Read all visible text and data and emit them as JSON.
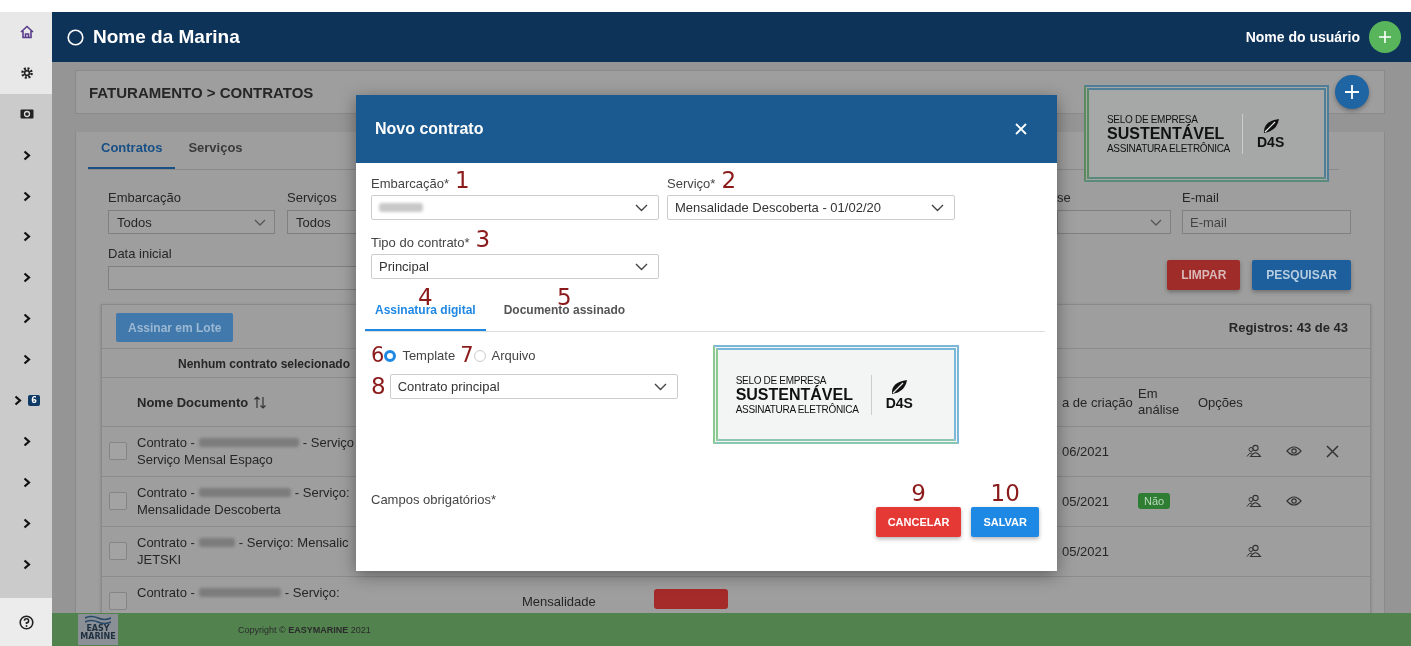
{
  "sidebar": {
    "items": [
      {
        "kind": "home"
      },
      {
        "kind": "settings"
      },
      {
        "kind": "money"
      },
      {
        "kind": "expand"
      },
      {
        "kind": "expand"
      },
      {
        "kind": "expand"
      },
      {
        "kind": "expand"
      },
      {
        "kind": "expand"
      },
      {
        "kind": "expand"
      },
      {
        "kind": "expand",
        "badge": "6"
      },
      {
        "kind": "expand"
      },
      {
        "kind": "expand"
      },
      {
        "kind": "expand"
      },
      {
        "kind": "expand"
      }
    ],
    "bottom": {
      "kind": "help"
    }
  },
  "header": {
    "brand": "Nome da Marina",
    "user": "Nome do usuário"
  },
  "page": {
    "breadcrumb": "FATURAMENTO > CONTRATOS",
    "seal": {
      "line1": "SELO DE EMPRESA",
      "line2": "SUSTENTÁVEL",
      "line3": "ASSINATURA ELETRÔNICA",
      "brand": "D4S"
    },
    "tabs": [
      {
        "label": "Contratos",
        "selected": true
      },
      {
        "label": "Serviços",
        "selected": false
      }
    ],
    "filters_left": [
      {
        "label": "Embarcação",
        "value": "Todos"
      },
      {
        "label": "Serviços",
        "value": "Todos"
      }
    ],
    "filters_right": [
      {
        "label": "se",
        "kind": "select"
      },
      {
        "label": "E-mail",
        "placeholder": "E-mail",
        "kind": "input"
      }
    ],
    "date_filter": {
      "label": "Data inicial"
    },
    "buttons": [
      {
        "label": "LIMPAR",
        "kind": "danger"
      },
      {
        "label": "PESQUISAR",
        "kind": "primary"
      }
    ]
  },
  "table": {
    "batch_button": "Assinar em Lote",
    "records": "Registros: 43 de 43",
    "selection_note": "Nenhum contrato selecionado",
    "columns": {
      "document": "Nome Documento",
      "created": "a de criação",
      "review": "Em análise",
      "options": "Opções"
    },
    "rows": [
      {
        "checked": false,
        "prefix": "Contrato -",
        "suffix": "- Serviço",
        "line2": "Serviço Mensal Espaço",
        "date": "06/2021",
        "actions": [
          {
            "kind": "team"
          },
          {
            "kind": "view"
          },
          {
            "kind": "delete"
          }
        ]
      },
      {
        "checked": false,
        "prefix": "Contrato -",
        "suffix": "- Serviço:",
        "line2": "Mensalidade Descoberta",
        "date": "05/2021",
        "status": {
          "label": "Não",
          "color": "#2e7d32"
        },
        "actions": [
          {
            "kind": "team"
          },
          {
            "kind": "view"
          }
        ]
      },
      {
        "checked": false,
        "prefix": "Contrato -",
        "suffix": "- Serviço: Mensalic",
        "line2": "JETSKI",
        "date": "05/2021",
        "actions": [
          {
            "kind": "team"
          }
        ]
      },
      {
        "checked": false,
        "prefix": "Contrato -",
        "suffix": "- Serviço:",
        "service": "Mensalidade",
        "status": {
          "color": "#a52a2a"
        }
      }
    ]
  },
  "modal": {
    "title": "Novo contrato",
    "fields": [
      {
        "label": "Embarcação*",
        "annotation": "1",
        "redacted": true
      },
      {
        "label": "Serviço*",
        "annotation": "2",
        "value": "Mensalidade Descoberta - 01/02/20",
        "redacted": false
      },
      {
        "label": "Tipo do contrato*",
        "annotation": "3",
        "value": "Principal",
        "redacted": false
      }
    ],
    "tabs": [
      {
        "label": "Assinatura digital",
        "annotation": "4",
        "selected": true
      },
      {
        "label": "Documento assinado",
        "annotation": "5",
        "selected": false
      }
    ],
    "radios": [
      {
        "label": "Template",
        "annotation": "6",
        "selected": true
      },
      {
        "label": "Arquivo",
        "annotation": "7",
        "selected": false
      }
    ],
    "template_select": {
      "annotation": "8",
      "value": "Contrato principal"
    },
    "seal": {
      "line1": "SELO DE EMPRESA",
      "line2": "SUSTENTÁVEL",
      "line3": "ASSINATURA ELETRÔNICA",
      "brand": "D4S"
    },
    "required_note": "Campos obrigatórios*",
    "buttons": [
      {
        "label": "CANCELAR",
        "annotation": "9",
        "kind": "danger"
      },
      {
        "label": "SALVAR",
        "annotation": "10",
        "kind": "primary"
      }
    ]
  },
  "footer": {
    "logo_top": "EASY",
    "logo_bottom": "MARINE",
    "copyright": "Copyright © **EASYMARINE** 2021"
  }
}
